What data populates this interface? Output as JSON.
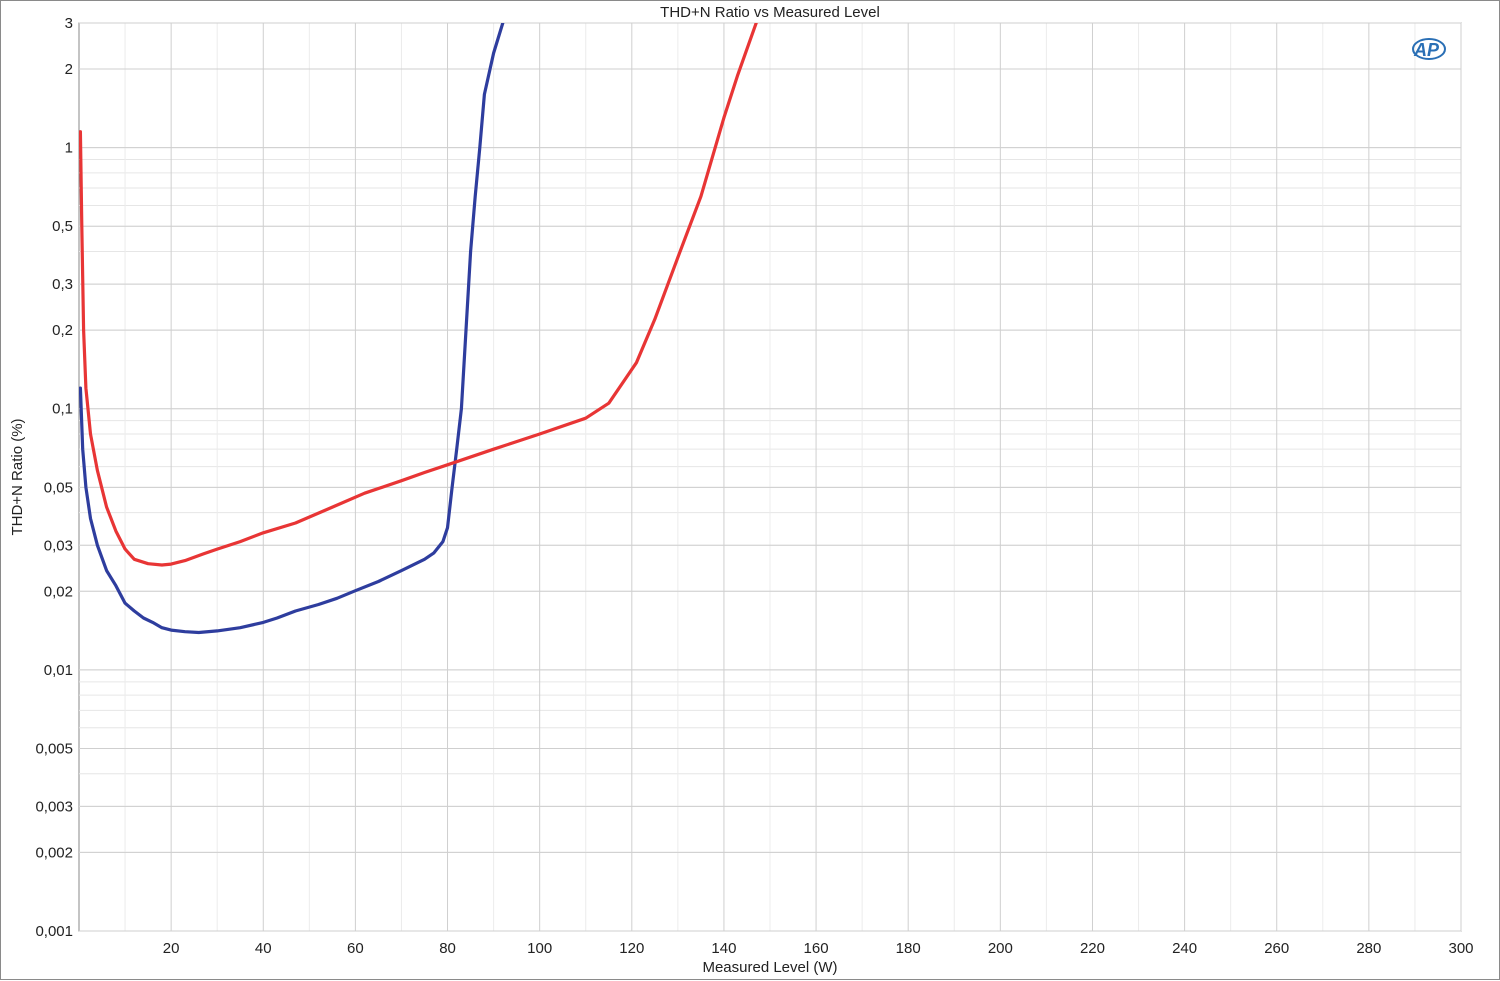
{
  "chart_data": {
    "type": "line",
    "title": "THD+N Ratio vs Measured Level",
    "xlabel": "Measured Level (W)",
    "ylabel": "THD+N Ratio (%)",
    "x_scale": "linear",
    "y_scale": "log",
    "xlim": [
      0,
      300
    ],
    "ylim": [
      0.001,
      3
    ],
    "grid": true,
    "legend": "none",
    "x_ticks": [
      "20",
      "40",
      "60",
      "80",
      "100",
      "120",
      "140",
      "160",
      "180",
      "200",
      "220",
      "240",
      "260",
      "280",
      "300"
    ],
    "y_ticks": [
      {
        "value": 3,
        "label": "3"
      },
      {
        "value": 2,
        "label": "2"
      },
      {
        "value": 1,
        "label": "1"
      },
      {
        "value": 0.5,
        "label": "0,5"
      },
      {
        "value": 0.3,
        "label": "0,3"
      },
      {
        "value": 0.2,
        "label": "0,2"
      },
      {
        "value": 0.1,
        "label": "0,1"
      },
      {
        "value": 0.05,
        "label": "0,05"
      },
      {
        "value": 0.03,
        "label": "0,03"
      },
      {
        "value": 0.02,
        "label": "0,02"
      },
      {
        "value": 0.01,
        "label": "0,01"
      },
      {
        "value": 0.005,
        "label": "0,005"
      },
      {
        "value": 0.003,
        "label": "0,003"
      },
      {
        "value": 0.002,
        "label": "0,002"
      },
      {
        "value": 0.001,
        "label": "0,001"
      }
    ],
    "series": [
      {
        "color": "#2e3d9e",
        "points": [
          [
            0.3,
            0.12
          ],
          [
            0.8,
            0.07
          ],
          [
            1.5,
            0.05
          ],
          [
            2.5,
            0.038
          ],
          [
            4,
            0.03
          ],
          [
            6,
            0.024
          ],
          [
            8,
            0.021
          ],
          [
            10,
            0.018
          ],
          [
            12,
            0.0168
          ],
          [
            14,
            0.0158
          ],
          [
            16,
            0.0152
          ],
          [
            18,
            0.0145
          ],
          [
            20,
            0.0142
          ],
          [
            23,
            0.014
          ],
          [
            26,
            0.0139
          ],
          [
            30,
            0.0141
          ],
          [
            35,
            0.0145
          ],
          [
            40,
            0.0152
          ],
          [
            43,
            0.0158
          ],
          [
            47,
            0.0168
          ],
          [
            52,
            0.0178
          ],
          [
            56,
            0.0188
          ],
          [
            60,
            0.0201
          ],
          [
            65,
            0.0218
          ],
          [
            70,
            0.024
          ],
          [
            75,
            0.0265
          ],
          [
            77,
            0.028
          ],
          [
            79,
            0.031
          ],
          [
            80,
            0.035
          ],
          [
            81,
            0.05
          ],
          [
            82,
            0.07
          ],
          [
            83,
            0.1
          ],
          [
            84,
            0.2
          ],
          [
            85,
            0.4
          ],
          [
            86,
            0.65
          ],
          [
            87,
            1.0
          ],
          [
            88,
            1.6
          ],
          [
            90,
            2.3
          ],
          [
            92,
            3.0
          ]
        ]
      },
      {
        "color": "#e83535",
        "points": [
          [
            0.3,
            1.15
          ],
          [
            0.6,
            0.5
          ],
          [
            1,
            0.2
          ],
          [
            1.5,
            0.12
          ],
          [
            2.5,
            0.08
          ],
          [
            4,
            0.058
          ],
          [
            6,
            0.042
          ],
          [
            8,
            0.034
          ],
          [
            10,
            0.029
          ],
          [
            12,
            0.0265
          ],
          [
            15,
            0.0255
          ],
          [
            18,
            0.0252
          ],
          [
            20,
            0.0254
          ],
          [
            23,
            0.0262
          ],
          [
            27,
            0.0278
          ],
          [
            30,
            0.029
          ],
          [
            35,
            0.031
          ],
          [
            40,
            0.0335
          ],
          [
            47,
            0.0365
          ],
          [
            55,
            0.042
          ],
          [
            62,
            0.0475
          ],
          [
            70,
            0.053
          ],
          [
            75,
            0.057
          ],
          [
            80,
            0.061
          ],
          [
            90,
            0.07
          ],
          [
            100,
            0.08
          ],
          [
            110,
            0.092
          ],
          [
            115,
            0.105
          ],
          [
            121,
            0.15
          ],
          [
            125,
            0.22
          ],
          [
            130,
            0.38
          ],
          [
            135,
            0.65
          ],
          [
            140,
            1.3
          ],
          [
            143,
            1.9
          ],
          [
            147,
            3.0
          ]
        ]
      }
    ]
  },
  "logo": {
    "text": "AP"
  }
}
